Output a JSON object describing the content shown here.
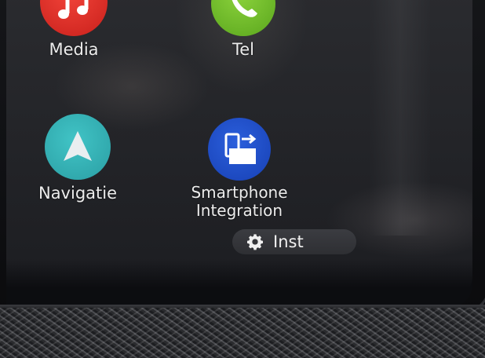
{
  "apps": {
    "media": {
      "label": "Media",
      "icon": "music-note-icon",
      "color": "#e2332b"
    },
    "tel": {
      "label": "Tel",
      "icon": "phone-handset-icon",
      "color": "#76c22e"
    },
    "navigatie": {
      "label": "Navigatie",
      "icon": "navigation-arrow-icon",
      "color": "#35b7b9"
    },
    "smartphone": {
      "label_line1": "Smartphone",
      "label_line2": "Integration",
      "icon": "phone-screen-mirroring-icon",
      "color": "#1f4fc9"
    }
  },
  "settings_button": {
    "label": "Inst",
    "icon": "gear-icon"
  }
}
